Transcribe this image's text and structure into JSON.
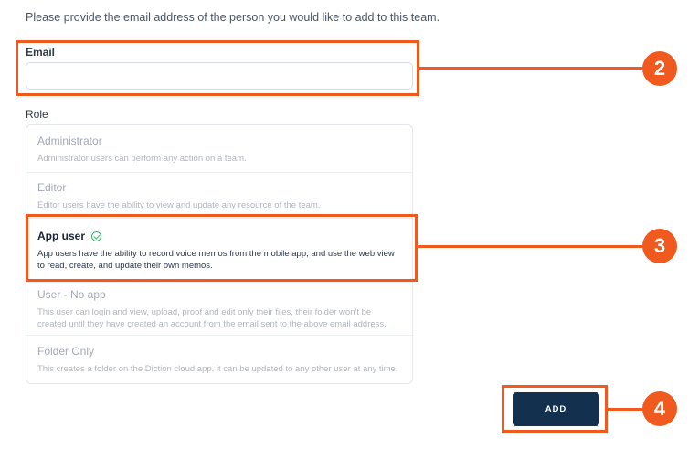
{
  "intro_text": "Please provide the email address of the person you would like to add to this team.",
  "email": {
    "label": "Email",
    "value": "",
    "placeholder": ""
  },
  "role": {
    "label": "Role",
    "options": [
      {
        "title": "Administrator",
        "description": "Administrator users can perform any action on a team.",
        "selected": false
      },
      {
        "title": "Editor",
        "description": "Editor users have the ability to view and update any resource of the team.",
        "selected": false
      },
      {
        "title": "App user",
        "description": "App users have the ability to record voice memos from the mobile app, and use the web view to read, create, and update their own memos.",
        "selected": true
      },
      {
        "title": "User - No app",
        "description": "This user can login and view, upload, proof and edit only their files, their folder won't be created until they have created an account from the email sent to the above email address.",
        "selected": false
      },
      {
        "title": "Folder Only",
        "description": "This creates a folder on the Diction cloud app, it can be updated to any other user at any time.",
        "selected": false
      }
    ]
  },
  "add_button_label": "ADD",
  "annotations": {
    "step_email": "2",
    "step_role": "3",
    "step_add": "4",
    "color": "#f05a1e"
  },
  "colors": {
    "button_bg": "#14304f",
    "check": "#3bb56b"
  }
}
